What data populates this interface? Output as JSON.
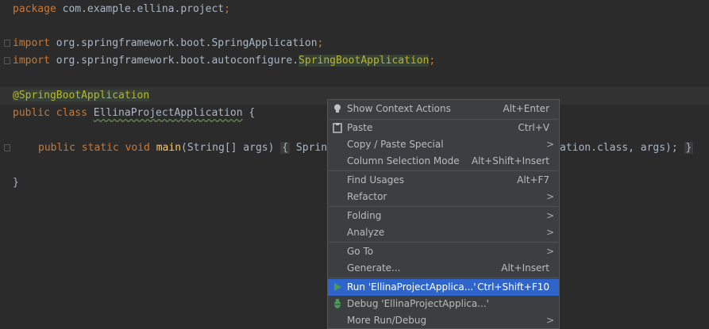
{
  "code": {
    "line1": {
      "kw": "package",
      "rest": " com.example.ellina.project",
      "end": ";"
    },
    "line2": {
      "kw": "import",
      "rest": " org.springframework.boot.SpringApplication",
      "end": ";"
    },
    "line3": {
      "kw": "import",
      "rest": " org.springframework.boot.autoconfigure.",
      "hl": "SpringBootApplication",
      "end": ";"
    },
    "line4": {
      "annotation": "@SpringBootApplication"
    },
    "line5": {
      "kw": "public class",
      "sp": " ",
      "cls": "EllinaProjectApplication",
      "rest": " {"
    },
    "line6": {
      "kw": "public static void",
      "sp": " ",
      "fn": "main",
      "args": "(String[] args)",
      "sp2": " ",
      "fold_open": "{",
      "body": " Sprin",
      "tail": "ation.class, args);",
      "sp3": " ",
      "fold_close": "}"
    },
    "line7": {
      "text": "}"
    }
  },
  "context_menu": {
    "items": [
      {
        "label": "Show Context Actions",
        "shortcut": "Alt+Enter",
        "icon": "bulb-icon"
      },
      {
        "label": "Paste",
        "shortcut": "Ctrl+V",
        "icon": "clipboard-icon"
      },
      {
        "label": "Copy / Paste Special",
        "submenu": ">"
      },
      {
        "label": "Column Selection Mode",
        "shortcut": "Alt+Shift+Insert"
      },
      {
        "label": "Find Usages",
        "shortcut": "Alt+F7"
      },
      {
        "label": "Refactor",
        "submenu": ">"
      },
      {
        "label": "Folding",
        "submenu": ">"
      },
      {
        "label": "Analyze",
        "submenu": ">"
      },
      {
        "label": "Go To",
        "submenu": ">"
      },
      {
        "label": "Generate...",
        "shortcut": "Alt+Insert"
      },
      {
        "label": "Run 'EllinaProjectApplica...'",
        "shortcut": "Ctrl+Shift+F10",
        "icon": "run-icon",
        "selected": true
      },
      {
        "label": "Debug 'EllinaProjectApplica...'",
        "icon": "debug-icon"
      },
      {
        "label": "More Run/Debug",
        "submenu": ">"
      }
    ]
  },
  "colors": {
    "background": "#2b2b2b",
    "keyword": "#cc7832",
    "annotation": "#bbb529",
    "menu_bg": "#3c3f41",
    "selection": "#2f65ca",
    "run_green": "#499c54"
  }
}
